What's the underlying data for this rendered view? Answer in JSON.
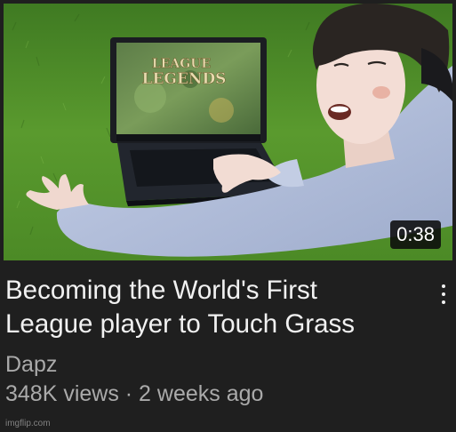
{
  "video": {
    "duration": "0:38",
    "title_line1": "Becoming the World's First",
    "title_line2": "League player to Touch Grass",
    "channel": "Dapz",
    "stats": "348K views · 2 weeks ago",
    "menu_icon": "more-vert-icon"
  },
  "thumbnail": {
    "screen_text_line1": "LEAGUE",
    "screen_text_line2": "LEGENDS"
  },
  "watermark": "imgflip.com",
  "colors": {
    "background": "#1f1f1f",
    "title": "#f1f1f1",
    "secondary_text": "#aaaaaa",
    "grass": "#4f8a2a",
    "jacket": "#b7c3de"
  }
}
